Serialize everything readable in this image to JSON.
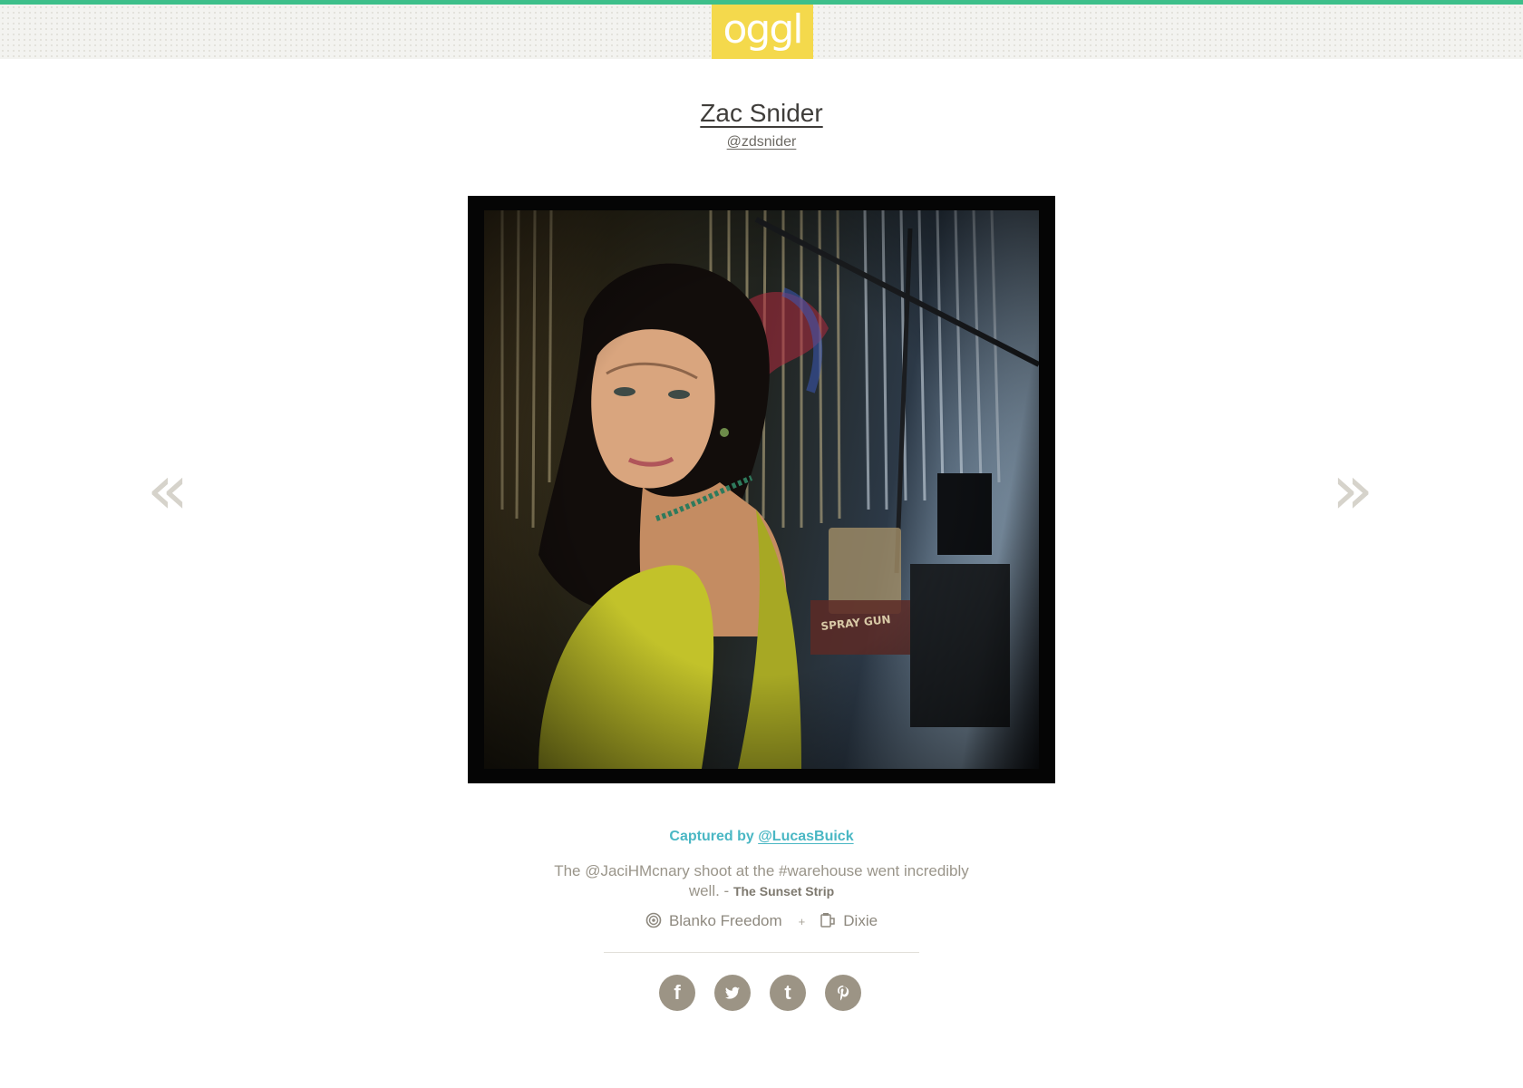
{
  "brand": {
    "logo_text": "oggl",
    "accent_color": "#3dbf8a",
    "logo_bg": "#f4d94c"
  },
  "profile": {
    "name": "Zac Snider",
    "handle": "@zdsnider"
  },
  "photo": {
    "alt": "Portrait photo"
  },
  "navigation": {
    "prev_icon": "double-chevron-left-icon",
    "next_icon": "double-chevron-right-icon",
    "prev_glyph": "«",
    "next_glyph": "»"
  },
  "details": {
    "captured_prefix": "Captured by",
    "captured_user": "@LucasBuick",
    "caption_text": "The @JaciHMcnary shoot at the #warehouse went incredibly well. -",
    "caption_location": "The Sunset Strip",
    "lens": "Blanko Freedom",
    "separator": "+",
    "film": "Dixie"
  },
  "share": [
    {
      "name": "facebook",
      "glyph": "f",
      "color": "#9c9485"
    },
    {
      "name": "twitter",
      "glyph": "",
      "color": "#9c9485"
    },
    {
      "name": "tumblr",
      "glyph": "t",
      "color": "#9c9485"
    },
    {
      "name": "pinterest",
      "glyph": "",
      "color": "#9c9485"
    }
  ]
}
